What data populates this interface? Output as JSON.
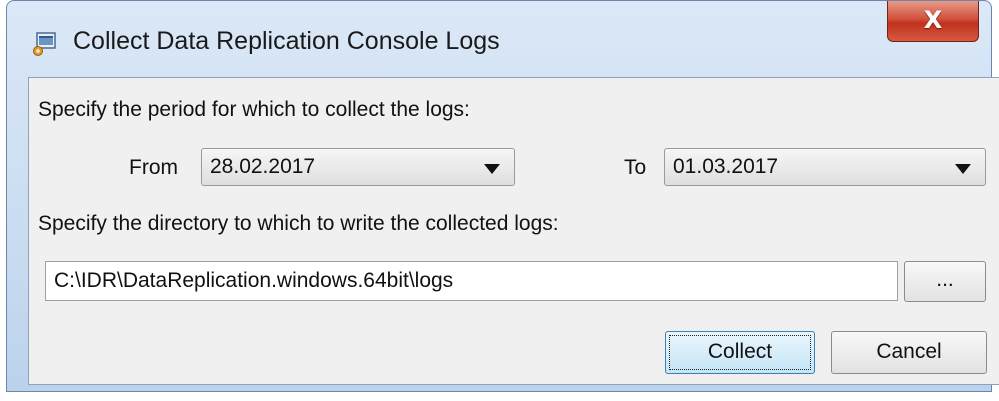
{
  "window": {
    "title": "Collect Data Replication Console Logs",
    "close_label": "X"
  },
  "period": {
    "prompt": "Specify the period for which to collect the logs:",
    "from_label": "From",
    "from_value": "28.02.2017",
    "to_label": "To",
    "to_value": "01.03.2017"
  },
  "directory": {
    "prompt": "Specify the directory to which to write the collected logs:",
    "path_value": "C:\\IDR\\DataReplication.windows.64bit\\logs",
    "browse_label": "..."
  },
  "actions": {
    "collect_label": "Collect",
    "cancel_label": "Cancel"
  },
  "icons": {
    "app": "console-window-icon",
    "dropdown": "chevron-down-icon"
  },
  "colors": {
    "titlebar": "#c9dcf1",
    "close_button": "#c0311f",
    "content_bg": "#f0f0f0"
  }
}
